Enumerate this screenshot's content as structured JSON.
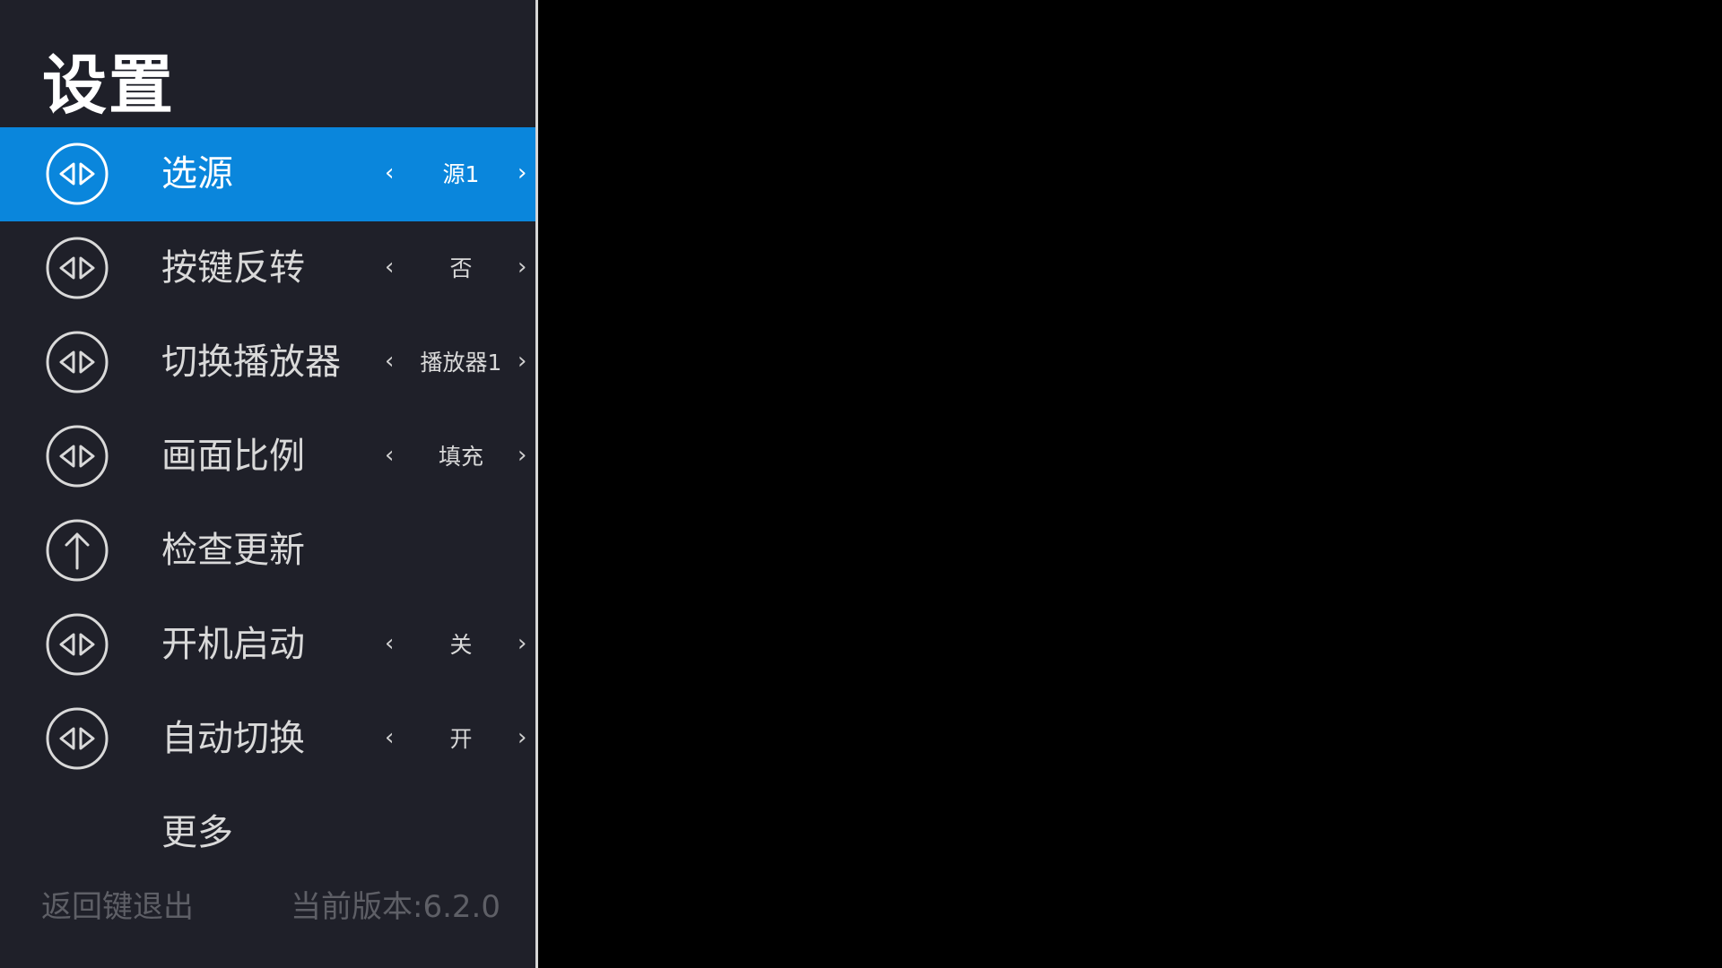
{
  "settings_panel": {
    "title": "设置",
    "items": [
      {
        "label": "选源",
        "icon": "left-right-arrows-icon",
        "value": "源1",
        "selected": true
      },
      {
        "label": "按键反转",
        "icon": "left-right-arrows-icon",
        "value": "否"
      },
      {
        "label": "切换播放器",
        "icon": "left-right-arrows-icon",
        "value": "播放器1"
      },
      {
        "label": "画面比例",
        "icon": "left-right-arrows-icon",
        "value": "填充"
      },
      {
        "label": "检查更新",
        "icon": "up-arrow-icon"
      },
      {
        "label": "开机启动",
        "icon": "left-right-arrows-icon",
        "value": "关"
      },
      {
        "label": "自动切换",
        "icon": "left-right-arrows-icon",
        "value": "开"
      },
      {
        "label": "更多"
      }
    ],
    "arrow_left": "‹",
    "arrow_right": "›",
    "footer": {
      "hint": "返回键退出",
      "version": "当前版本:6.2.0"
    }
  },
  "colors": {
    "panel_background": "#1f2029",
    "selected_background": "#0a86dc",
    "footer_text": "#5e5f66",
    "screen_background": "#000000"
  }
}
